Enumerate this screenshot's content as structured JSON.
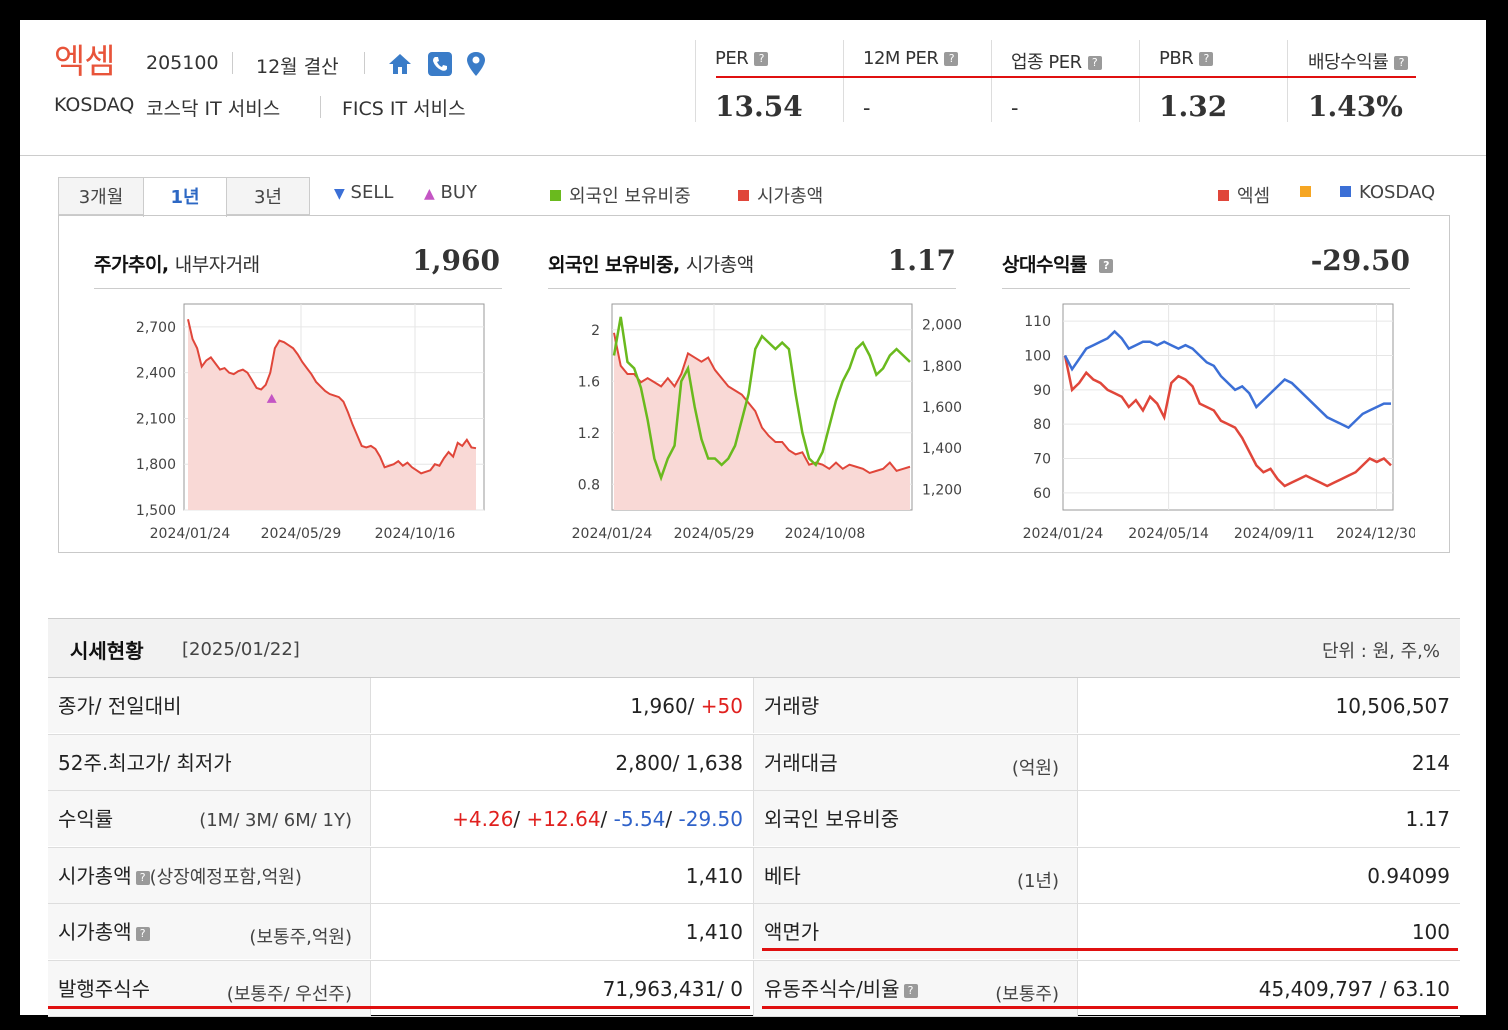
{
  "header": {
    "company": "엑셈",
    "code": "205100",
    "fiscal": "12월 결산",
    "market": "KOSDAQ",
    "industry": "코스닥 IT 서비스",
    "fics": "FICS IT 서비스",
    "icons": [
      "home-icon",
      "phone-icon",
      "map-pin-icon"
    ]
  },
  "metrics": [
    {
      "label": "PER",
      "value": "13.54"
    },
    {
      "label": "12M PER",
      "value": "-"
    },
    {
      "label": "업종 PER",
      "value": "-"
    },
    {
      "label": "PBR",
      "value": "1.32"
    },
    {
      "label": "배당수익률",
      "value": "1.43%"
    }
  ],
  "tabs": [
    "3개월",
    "1년",
    "3년"
  ],
  "active_tab": "1년",
  "legend": {
    "sell": "SELL",
    "buy": "BUY",
    "foreign": "외국인 보유비중",
    "mktcap": "시가총액",
    "company": "엑셈",
    "kosdaq": "KOSDAQ"
  },
  "colors": {
    "red": "#e0463a",
    "green": "#6aba1e",
    "blue": "#3b6fd6",
    "orange": "#f6a623",
    "purple": "#c455c4"
  },
  "chart_data": [
    {
      "type": "area",
      "title": "주가추이",
      "subtitle": "내부자거래",
      "value": "1,960",
      "ylim": [
        1500,
        2850
      ],
      "yticks": [
        "2,700",
        "2,400",
        "2,100",
        "1,800",
        "1,500"
      ],
      "xticks": [
        "2024/01/24",
        "2024/05/29",
        "2024/10/16"
      ],
      "series": [
        {
          "values": [
            2750,
            2620,
            2560,
            2440,
            2480,
            2500,
            2460,
            2420,
            2430,
            2400,
            2390,
            2410,
            2420,
            2400,
            2350,
            2300,
            2290,
            2320,
            2400,
            2560,
            2610,
            2600,
            2580,
            2560,
            2520,
            2470,
            2430,
            2390,
            2340,
            2310,
            2280,
            2260,
            2250,
            2240,
            2210,
            2140,
            2060,
            1990,
            1920,
            1910,
            1920,
            1900,
            1850,
            1780,
            1790,
            1800,
            1820,
            1790,
            1810,
            1780,
            1760,
            1740,
            1750,
            1760,
            1800,
            1790,
            1840,
            1880,
            1850,
            1940,
            1920,
            1960,
            1910,
            1905
          ]
        }
      ],
      "markers": [
        {
          "type": "BUY",
          "x_index": 17
        }
      ]
    },
    {
      "type": "line",
      "title": "외국인 보유비중",
      "subtitle": "시가총액",
      "value": "1.17",
      "ylim_left": [
        0.6,
        2.2
      ],
      "ylim_right": [
        1100,
        2100
      ],
      "yticks_left": [
        "2",
        "1.6",
        "1.2",
        "0.8"
      ],
      "yticks_right": [
        "2,000",
        "1,800",
        "1,600",
        "1,400",
        "1,200"
      ],
      "xticks": [
        "2024/01/24",
        "2024/05/29",
        "2024/10/08"
      ],
      "series": [
        {
          "name": "시가총액",
          "values": [
            1960,
            1800,
            1760,
            1760,
            1720,
            1740,
            1720,
            1700,
            1740,
            1700,
            1760,
            1860,
            1840,
            1820,
            1840,
            1780,
            1740,
            1700,
            1680,
            1660,
            1620,
            1580,
            1500,
            1460,
            1430,
            1430,
            1390,
            1370,
            1380,
            1320,
            1330,
            1320,
            1300,
            1330,
            1300,
            1320,
            1310,
            1300,
            1280,
            1290,
            1300,
            1330,
            1290,
            1300,
            1310
          ]
        },
        {
          "name": "외국인 보유비중",
          "values": [
            1.8,
            2.1,
            1.75,
            1.7,
            1.55,
            1.3,
            1.0,
            0.85,
            1.0,
            1.1,
            1.6,
            1.7,
            1.4,
            1.15,
            1.0,
            1.0,
            0.95,
            1.0,
            1.1,
            1.3,
            1.5,
            1.85,
            1.95,
            1.9,
            1.85,
            1.9,
            1.85,
            1.5,
            1.2,
            1.0,
            0.95,
            1.05,
            1.25,
            1.45,
            1.6,
            1.7,
            1.85,
            1.9,
            1.8,
            1.65,
            1.7,
            1.8,
            1.85,
            1.8,
            1.75
          ]
        }
      ]
    },
    {
      "type": "line",
      "title": "상대수익률",
      "value": "-29.50",
      "ylim": [
        55,
        115
      ],
      "yticks": [
        "110",
        "100",
        "90",
        "80",
        "70",
        "60"
      ],
      "xticks": [
        "2024/01/24",
        "2024/05/14",
        "2024/09/11",
        "2024/12/30"
      ],
      "series": [
        {
          "name": "엑셈",
          "values": [
            100,
            90,
            92,
            95,
            93,
            92,
            90,
            89,
            88,
            85,
            87,
            84,
            88,
            86,
            82,
            92,
            94,
            93,
            91,
            86,
            85,
            84,
            81,
            80,
            79,
            76,
            72,
            68,
            66,
            67,
            64,
            62,
            63,
            64,
            65,
            64,
            63,
            62,
            63,
            64,
            65,
            66,
            68,
            70,
            69,
            70,
            68
          ]
        },
        {
          "name": "KOSDAQ",
          "values": [
            100,
            96,
            99,
            102,
            103,
            104,
            105,
            107,
            105,
            102,
            103,
            104,
            104,
            103,
            104,
            103,
            102,
            103,
            102,
            100,
            98,
            97,
            94,
            92,
            90,
            91,
            89,
            85,
            87,
            89,
            91,
            93,
            92,
            90,
            88,
            86,
            84,
            82,
            81,
            80,
            79,
            81,
            83,
            84,
            85,
            86,
            86
          ]
        }
      ]
    }
  ],
  "chart_labels": {
    "price_title": "주가추이,",
    "price_sub": "내부자거래",
    "price_value": "1,960",
    "foreign_title": "외국인 보유비중,",
    "foreign_sub": "시가총액",
    "foreign_value": "1.17",
    "rel_title": "상대수익률",
    "rel_value": "-29.50"
  },
  "table": {
    "title": "시세현황",
    "date": "[2025/01/22]",
    "unit": "단위 : 원, 주,%",
    "rows": [
      {
        "l1": "종가/ 전일대비",
        "l1s": "",
        "v1": "1,960/ ",
        "v1b": "+50",
        "l2": "거래량",
        "l2s": "",
        "v2": "10,506,507"
      },
      {
        "l1": "52주.최고가/ 최저가",
        "l1s": "",
        "v1": "2,800/ 1,638",
        "l2": "거래대금",
        "l2s": "(억원)",
        "v2": "214"
      },
      {
        "l1": "수익률",
        "l1s": "(1M/ 3M/ 6M/ 1Y)",
        "r1": "+4.26",
        "r2": "+12.64",
        "r3": "-5.54",
        "r4": "-29.50",
        "l2": "외국인 보유비중",
        "l2s": "",
        "v2": "1.17"
      },
      {
        "l1": "시가총액",
        "l1s": "(상장예정포함,억원)",
        "v1": "1,410",
        "l2": "베타",
        "l2s": "(1년)",
        "v2": "0.94099"
      },
      {
        "l1": "시가총액",
        "l1s": "(보통주,억원)",
        "v1": "1,410",
        "l2": "액면가",
        "l2s": "",
        "v2": "100"
      },
      {
        "l1": "발행주식수",
        "l1s": "(보통주/ 우선주)",
        "v1": "71,963,431/ 0",
        "l2": "유동주식수/비율",
        "l2s": "(보통주)",
        "v2": "45,409,797 / 63.10"
      }
    ]
  }
}
